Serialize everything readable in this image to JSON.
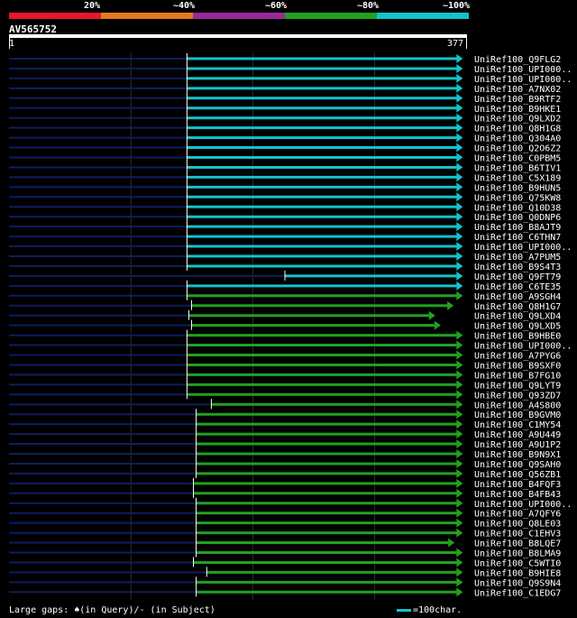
{
  "legend": {
    "colors": [
      "#e8162e",
      "#e4791c",
      "#962a98",
      "#22a022",
      "#11c3cc"
    ],
    "labels": [
      "20%",
      "~40%",
      "~60%",
      "~80%",
      "~100%"
    ]
  },
  "query": {
    "name": "AV565752",
    "start": "1",
    "end": "377"
  },
  "hits": [
    {
      "name": "UniRef100_Q9FLG2",
      "color": "#11c3cc",
      "start": 0.387,
      "end": 0.985
    },
    {
      "name": "UniRef100_UPI000..",
      "color": "#11c3cc",
      "start": 0.387,
      "end": 0.985
    },
    {
      "name": "UniRef100_UPI000..",
      "color": "#11c3cc",
      "start": 0.387,
      "end": 0.985
    },
    {
      "name": "UniRef100_A7NX02",
      "color": "#11c3cc",
      "start": 0.387,
      "end": 0.985
    },
    {
      "name": "UniRef100_B9RTF2",
      "color": "#11c3cc",
      "start": 0.387,
      "end": 0.985
    },
    {
      "name": "UniRef100_B9HKE1",
      "color": "#11c3cc",
      "start": 0.387,
      "end": 0.985
    },
    {
      "name": "UniRef100_Q9LXD2",
      "color": "#11c3cc",
      "start": 0.387,
      "end": 0.985
    },
    {
      "name": "UniRef100_Q8H1G8",
      "color": "#11c3cc",
      "start": 0.387,
      "end": 0.985
    },
    {
      "name": "UniRef100_Q304A0",
      "color": "#11c3cc",
      "start": 0.387,
      "end": 0.985
    },
    {
      "name": "UniRef100_Q2O6Z2",
      "color": "#11c3cc",
      "start": 0.387,
      "end": 0.985
    },
    {
      "name": "UniRef100_C0PBM5",
      "color": "#11c3cc",
      "start": 0.387,
      "end": 0.985
    },
    {
      "name": "UniRef100_B6TIV1",
      "color": "#11c3cc",
      "start": 0.387,
      "end": 0.985
    },
    {
      "name": "UniRef100_C5X189",
      "color": "#11c3cc",
      "start": 0.387,
      "end": 0.985
    },
    {
      "name": "UniRef100_B9HUN5",
      "color": "#11c3cc",
      "start": 0.387,
      "end": 0.985
    },
    {
      "name": "UniRef100_Q75KW8",
      "color": "#11c3cc",
      "start": 0.387,
      "end": 0.985
    },
    {
      "name": "UniRef100_Q10D38",
      "color": "#11c3cc",
      "start": 0.387,
      "end": 0.985
    },
    {
      "name": "UniRef100_Q0DNP6",
      "color": "#11c3cc",
      "start": 0.387,
      "end": 0.985
    },
    {
      "name": "UniRef100_B8AJT9",
      "color": "#11c3cc",
      "start": 0.387,
      "end": 0.985
    },
    {
      "name": "UniRef100_C6THN7",
      "color": "#11c3cc",
      "start": 0.387,
      "end": 0.985
    },
    {
      "name": "UniRef100_UPI000..",
      "color": "#11c3cc",
      "start": 0.387,
      "end": 0.985
    },
    {
      "name": "UniRef100_A7PUM5",
      "color": "#11c3cc",
      "start": 0.387,
      "end": 0.985
    },
    {
      "name": "UniRef100_B9S4T3",
      "color": "#11c3cc",
      "start": 0.387,
      "end": 0.985
    },
    {
      "name": "UniRef100_Q9FT79",
      "color": "#11c3cc",
      "start": 0.6,
      "end": 0.985
    },
    {
      "name": "UniRef100_C6TE35",
      "color": "#11c3cc",
      "start": 0.387,
      "end": 0.985
    },
    {
      "name": "UniRef100_A9SGH4",
      "color": "#22a022",
      "start": 0.387,
      "end": 0.985
    },
    {
      "name": "UniRef100_Q8H1G7",
      "color": "#22a022",
      "start": 0.397,
      "end": 0.965
    },
    {
      "name": "UniRef100_Q9LXD4",
      "color": "#22a022",
      "start": 0.391,
      "end": 0.925
    },
    {
      "name": "UniRef100_Q9LXD5",
      "color": "#22a022",
      "start": 0.397,
      "end": 0.937
    },
    {
      "name": "UniRef100_B9HBE0",
      "color": "#22a022",
      "start": 0.387,
      "end": 0.985
    },
    {
      "name": "UniRef100_UPI000..",
      "color": "#22a022",
      "start": 0.387,
      "end": 0.985
    },
    {
      "name": "UniRef100_A7PYG6",
      "color": "#22a022",
      "start": 0.387,
      "end": 0.985
    },
    {
      "name": "UniRef100_B9SXF0",
      "color": "#22a022",
      "start": 0.387,
      "end": 0.985
    },
    {
      "name": "UniRef100_B7FG10",
      "color": "#22a022",
      "start": 0.387,
      "end": 0.985
    },
    {
      "name": "UniRef100_Q9LYT9",
      "color": "#22a022",
      "start": 0.387,
      "end": 0.985
    },
    {
      "name": "UniRef100_Q93ZD7",
      "color": "#22a022",
      "start": 0.387,
      "end": 0.985
    },
    {
      "name": "UniRef100_A4S800",
      "color": "#22a022",
      "start": 0.44,
      "end": 0.985
    },
    {
      "name": "UniRef100_B9GVM0",
      "color": "#22a022",
      "start": 0.407,
      "end": 0.985
    },
    {
      "name": "UniRef100_C1MY54",
      "color": "#22a022",
      "start": 0.407,
      "end": 0.985
    },
    {
      "name": "UniRef100_A9U449",
      "color": "#22a022",
      "start": 0.407,
      "end": 0.985
    },
    {
      "name": "UniRef100_A9U1P2",
      "color": "#22a022",
      "start": 0.407,
      "end": 0.985
    },
    {
      "name": "UniRef100_B9N9X1",
      "color": "#22a022",
      "start": 0.407,
      "end": 0.985
    },
    {
      "name": "UniRef100_Q9SAH0",
      "color": "#22a022",
      "start": 0.407,
      "end": 0.985
    },
    {
      "name": "UniRef100_Q56ZB1",
      "color": "#22a022",
      "start": 0.407,
      "end": 0.985
    },
    {
      "name": "UniRef100_B4FQF3",
      "color": "#22a022",
      "start": 0.401,
      "end": 0.985
    },
    {
      "name": "UniRef100_B4FB43",
      "color": "#22a022",
      "start": 0.401,
      "end": 0.985
    },
    {
      "name": "UniRef100_UPI000..",
      "color": "#22a022",
      "start": 0.407,
      "end": 0.985
    },
    {
      "name": "UniRef100_A7QFY6",
      "color": "#22a022",
      "start": 0.407,
      "end": 0.985
    },
    {
      "name": "UniRef100_Q8LE03",
      "color": "#22a022",
      "start": 0.407,
      "end": 0.985
    },
    {
      "name": "UniRef100_C1EHV3",
      "color": "#22a022",
      "start": 0.407,
      "end": 0.985
    },
    {
      "name": "UniRef100_B8LQE7",
      "color": "#22a022",
      "start": 0.407,
      "end": 0.967
    },
    {
      "name": "UniRef100_B8LMA9",
      "color": "#22a022",
      "start": 0.407,
      "end": 0.985
    },
    {
      "name": "UniRef100_C5WTI0",
      "color": "#22a022",
      "start": 0.401,
      "end": 0.985
    },
    {
      "name": "UniRef100_B9HIE8",
      "color": "#22a022",
      "start": 0.43,
      "end": 0.985
    },
    {
      "name": "UniRef100_Q9S9N4",
      "color": "#22a022",
      "start": 0.407,
      "end": 0.985
    },
    {
      "name": "UniRef100_C1EDG7",
      "color": "#22a022",
      "start": 0.407,
      "end": 0.985
    }
  ],
  "footer": {
    "gaps_text": "Large gaps: ♠(in Query)/- (in Subject)",
    "scale_text": "=100char."
  }
}
